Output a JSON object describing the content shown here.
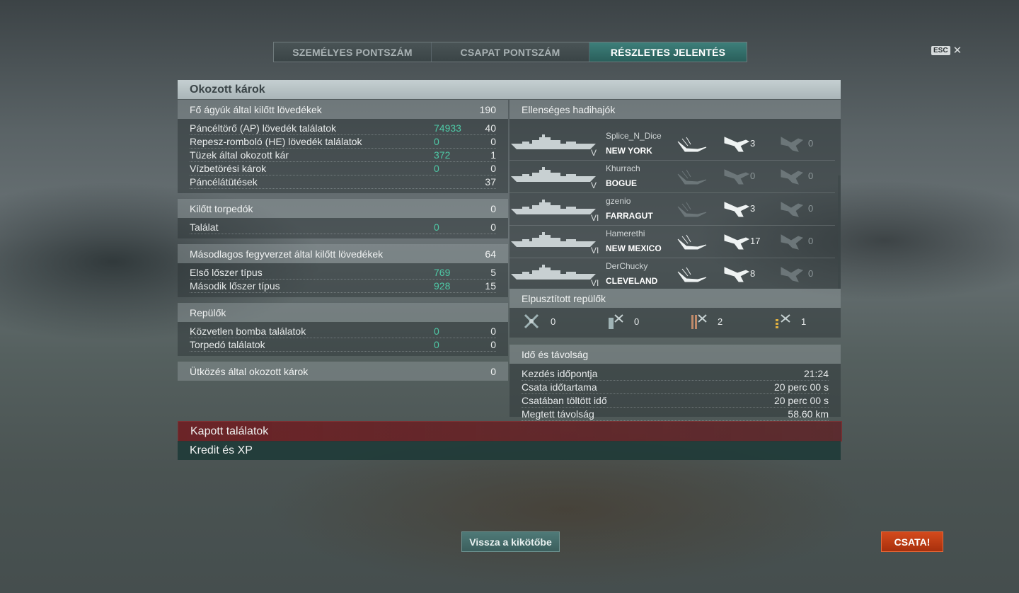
{
  "tabs": [
    {
      "label": "SZEMÉLYES PONTSZÁM",
      "active": false
    },
    {
      "label": "CSAPAT PONTSZÁM",
      "active": false
    },
    {
      "label": "RÉSZLETES JELENTÉS",
      "active": true
    }
  ],
  "esc": {
    "key": "ESC",
    "close": "✕"
  },
  "panel_title": "Okozott károk",
  "left": {
    "main_guns": {
      "title": "Fő ágyúk által kilőtt lövedékek",
      "value": "190",
      "rows": [
        {
          "label": "Páncéltörő (AP) lövedék találatok",
          "green": "74933",
          "value": "40"
        },
        {
          "label": "Repesz-romboló (HE) lövedék találatok",
          "green": "0",
          "value": "0"
        },
        {
          "label": "Tüzek által okozott kár",
          "green": "372",
          "value": "1"
        },
        {
          "label": "Vízbetörési károk",
          "green": "0",
          "value": "0"
        },
        {
          "label": "Páncélátütések",
          "green": "",
          "value": "37"
        }
      ]
    },
    "torpedoes": {
      "title": "Kilőtt torpedók",
      "value": "0",
      "rows": [
        {
          "label": "Találat",
          "green": "0",
          "value": "0"
        }
      ]
    },
    "secondary": {
      "title": "Másodlagos fegyverzet által kilőtt lövedékek",
      "value": "64",
      "rows": [
        {
          "label": "Első lőszer típus",
          "green": "769",
          "value": "5"
        },
        {
          "label": "Második lőszer típus",
          "green": "928",
          "value": "15"
        }
      ]
    },
    "planes": {
      "title": "Repülők",
      "value": "",
      "rows": [
        {
          "label": "Közvetlen bomba találatok",
          "green": "0",
          "value": "0"
        },
        {
          "label": "Torpedó találatok",
          "green": "0",
          "value": "0"
        }
      ]
    },
    "ramming": {
      "title": "Ütközés által okozott károk",
      "value": "0"
    }
  },
  "right": {
    "enemy_title": "Ellenséges hadihajók",
    "ships": [
      {
        "player": "Splice_N_Dice",
        "ship": "NEW YORK",
        "tier": "V",
        "hits": "3",
        "hits2": "0",
        "icon1_active": true,
        "icon2_active": true
      },
      {
        "player": "Khurrach",
        "ship": "BOGUE",
        "tier": "V",
        "hits": "0",
        "hits2": "0",
        "icon1_active": false,
        "icon2_active": false
      },
      {
        "player": "gzenio",
        "ship": "FARRAGUT",
        "tier": "VI",
        "hits": "3",
        "hits2": "0",
        "icon1_active": false,
        "icon2_active": true
      },
      {
        "player": "Hamerethi",
        "ship": "NEW MEXICO",
        "tier": "VI",
        "hits": "17",
        "hits2": "0",
        "icon1_active": true,
        "icon2_active": true
      },
      {
        "player": "DerChucky",
        "ship": "CLEVELAND",
        "tier": "VI",
        "hits": "8",
        "hits2": "0",
        "icon1_active": true,
        "icon2_active": true
      }
    ],
    "planes_title": "Elpusztított repülők",
    "planes": [
      {
        "icon": "fighter-plane-icon",
        "value": "0"
      },
      {
        "icon": "bomber-plane-icon",
        "value": "0"
      },
      {
        "icon": "torpedo-bomber-icon",
        "value": "2"
      },
      {
        "icon": "scout-plane-icon",
        "value": "1"
      }
    ],
    "time_title": "Idő és távolság",
    "time_rows": [
      {
        "label": "Kezdés időpontja",
        "value": "21:24"
      },
      {
        "label": "Csata időtartama",
        "value": "20 perc 00 s"
      },
      {
        "label": "Csatában töltött idő",
        "value": "20 perc 00 s"
      },
      {
        "label": "Megtett távolság",
        "value": "58.60 km"
      }
    ]
  },
  "bars": {
    "received": "Kapott találatok",
    "credits": "Kredit és XP"
  },
  "buttons": {
    "back": "Vissza a kikötőbe",
    "battle": "CSATA!"
  }
}
